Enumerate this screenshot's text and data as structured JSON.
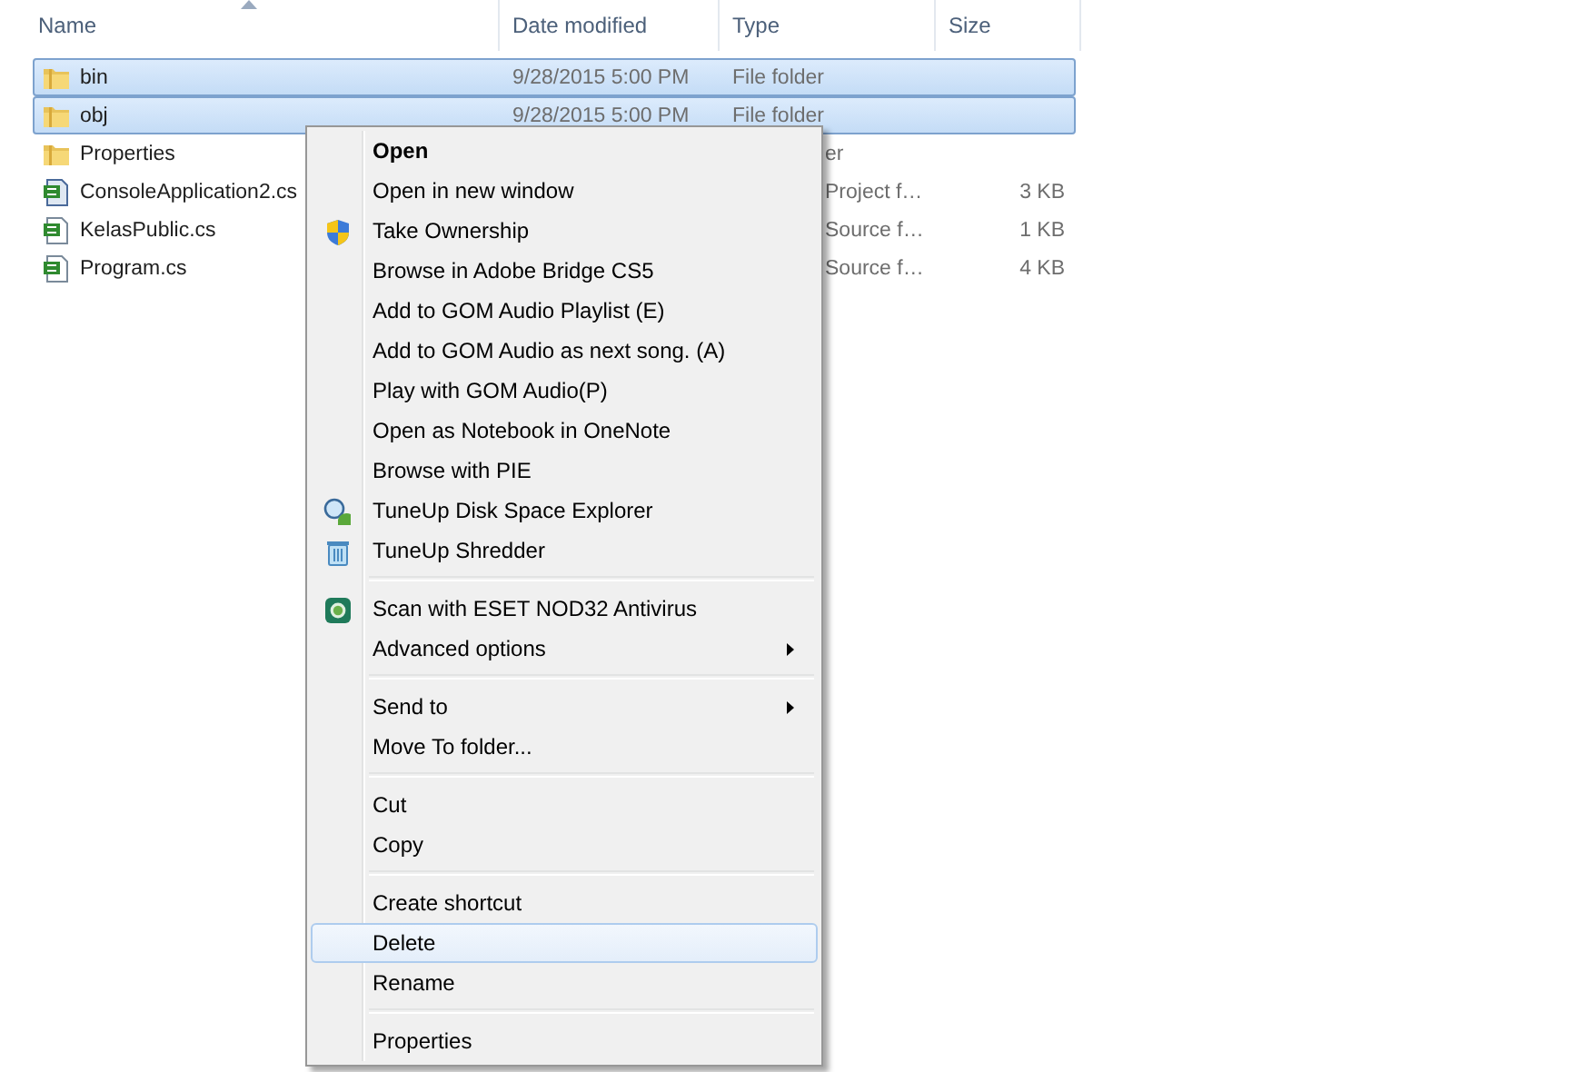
{
  "columns": [
    {
      "label": "Name",
      "sorted": true
    },
    {
      "label": "Date modified",
      "sorted": false
    },
    {
      "label": "Type",
      "sorted": false
    },
    {
      "label": "Size",
      "sorted": false
    }
  ],
  "rows": [
    {
      "kind": "folder",
      "name": "bin",
      "date": "9/28/2015 5:00 PM",
      "type": "File folder",
      "size": "",
      "selected": true,
      "type_clipped": false
    },
    {
      "kind": "folder",
      "name": "obj",
      "date": "9/28/2015 5:00 PM",
      "type": "File folder",
      "size": "",
      "selected": true,
      "type_clipped": false
    },
    {
      "kind": "folder",
      "name": "Properties",
      "type": "er",
      "size": "",
      "selected": false,
      "type_clipped": true
    },
    {
      "kind": "project",
      "name": "ConsoleApplication2.cs",
      "type": "Project f…",
      "size": "3 KB",
      "selected": false,
      "type_clipped": true
    },
    {
      "kind": "code",
      "name": "KelasPublic.cs",
      "type": "Source f…",
      "size": "1 KB",
      "selected": false,
      "type_clipped": true
    },
    {
      "kind": "code",
      "name": "Program.cs",
      "type": "Source f…",
      "size": "4 KB",
      "selected": false,
      "type_clipped": true
    }
  ],
  "menu": [
    [
      {
        "label": "Open",
        "default": true,
        "submenu": false,
        "selected": false
      },
      {
        "label": "Open in new window",
        "default": false,
        "submenu": false,
        "selected": false
      },
      {
        "label": "Take Ownership",
        "kind": "shield",
        "default": false,
        "submenu": false,
        "selected": false
      },
      {
        "label": "Browse in Adobe Bridge CS5",
        "default": false,
        "submenu": false,
        "selected": false
      },
      {
        "label": "Add to GOM Audio Playlist (E)",
        "default": false,
        "submenu": false,
        "selected": false
      },
      {
        "label": "Add to GOM Audio as next song. (A)",
        "default": false,
        "submenu": false,
        "selected": false
      },
      {
        "label": "Play with GOM Audio(P)",
        "default": false,
        "submenu": false,
        "selected": false
      },
      {
        "label": "Open as Notebook in OneNote",
        "default": false,
        "submenu": false,
        "selected": false
      },
      {
        "label": "Browse with PIE",
        "default": false,
        "submenu": false,
        "selected": false
      },
      {
        "label": "TuneUp Disk Space Explorer",
        "kind": "magnifier",
        "default": false,
        "submenu": false,
        "selected": false
      },
      {
        "label": "TuneUp Shredder",
        "kind": "trash",
        "default": false,
        "submenu": false,
        "selected": false
      }
    ],
    [
      {
        "label": "Scan with ESET NOD32 Antivirus",
        "kind": "scan",
        "default": false,
        "submenu": false,
        "selected": false
      },
      {
        "label": "Advanced options",
        "default": false,
        "submenu": true,
        "selected": false
      }
    ],
    [
      {
        "label": "Send to",
        "default": false,
        "submenu": true,
        "selected": false
      },
      {
        "label": "Move To folder...",
        "default": false,
        "submenu": false,
        "selected": false
      }
    ],
    [
      {
        "label": "Cut",
        "default": false,
        "submenu": false,
        "selected": false
      },
      {
        "label": "Copy",
        "default": false,
        "submenu": false,
        "selected": false
      }
    ],
    [
      {
        "label": "Create shortcut",
        "default": false,
        "submenu": false,
        "selected": false
      },
      {
        "label": "Delete",
        "default": false,
        "submenu": false,
        "selected": true
      },
      {
        "label": "Rename",
        "default": false,
        "submenu": false,
        "selected": false
      }
    ],
    [
      {
        "label": "Properties",
        "default": false,
        "submenu": false,
        "selected": false
      }
    ]
  ]
}
